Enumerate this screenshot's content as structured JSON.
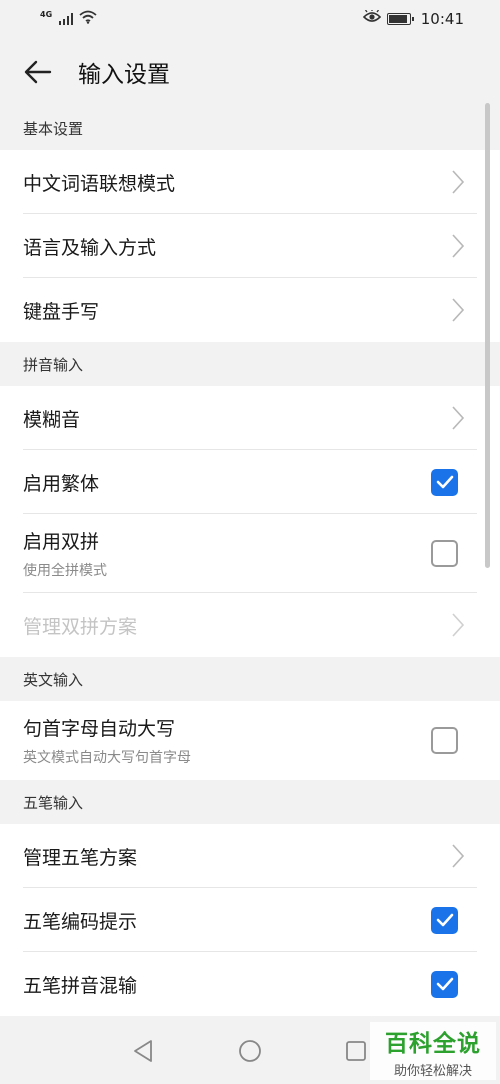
{
  "status_bar": {
    "network": "4G",
    "time": "10:41",
    "battery_level": 0.9
  },
  "header": {
    "title": "输入设置"
  },
  "sections": {
    "basic": {
      "title": "基本设置",
      "items": [
        {
          "label": "中文词语联想模式"
        },
        {
          "label": "语言及输入方式"
        },
        {
          "label": "键盘手写"
        }
      ]
    },
    "pinyin": {
      "title": "拼音输入",
      "items": [
        {
          "label": "模糊音"
        },
        {
          "label": "启用繁体",
          "checked": true
        },
        {
          "label": "启用双拼",
          "sub": "使用全拼模式",
          "checked": false
        },
        {
          "label": "管理双拼方案",
          "disabled": true
        }
      ]
    },
    "english": {
      "title": "英文输入",
      "items": [
        {
          "label": "句首字母自动大写",
          "sub": "英文模式自动大写句首字母",
          "checked": false
        }
      ]
    },
    "wubi": {
      "title": "五笔输入",
      "items": [
        {
          "label": "管理五笔方案"
        },
        {
          "label": "五笔编码提示",
          "checked": true
        },
        {
          "label": "五笔拼音混输",
          "checked": true
        }
      ]
    }
  },
  "watermark": {
    "title": "百科全说",
    "subtitle": "助你轻松解决"
  },
  "colors": {
    "accent": "#1a73e8",
    "background": "#f2f2f2",
    "watermark_green": "#2ca12e"
  }
}
